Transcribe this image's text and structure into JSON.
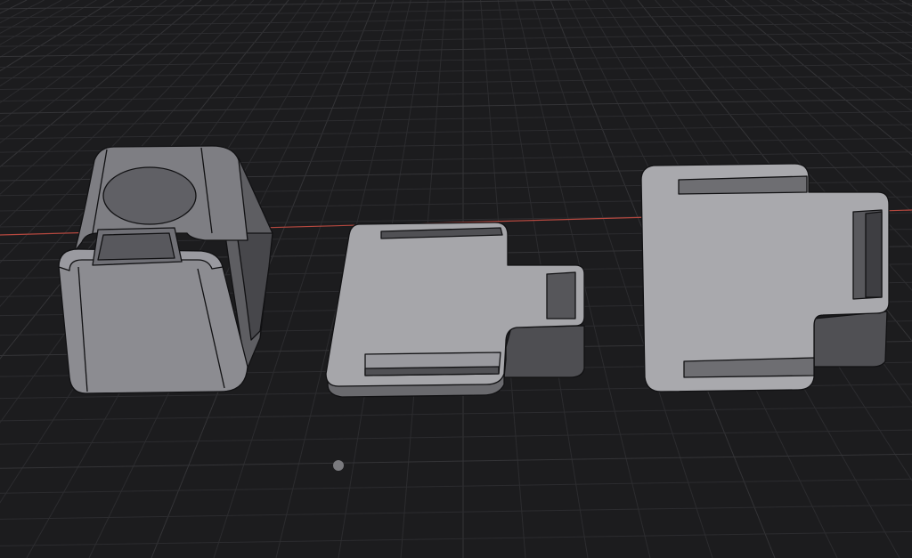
{
  "viewport": {
    "background_color": "#1c1c1e",
    "grid_minor_color": "#2a2a2c",
    "grid_major_color": "#343437",
    "x_axis_color": "#b5483f"
  },
  "scene": {
    "objects": [
      {
        "name": "box-enclosure",
        "description": "box"
      },
      {
        "name": "flat-plate-small",
        "description": "plate"
      },
      {
        "name": "flat-plate-large",
        "description": "plate"
      }
    ],
    "mesh_face_color": "#a6a6aa",
    "mesh_side_color": "#6a6a6e",
    "mesh_dark_color": "#505054",
    "mesh_edge_color": "#111113"
  },
  "gizmo": {
    "pivot_icon": "origin-point-icon",
    "color": "#7a7a7e"
  }
}
